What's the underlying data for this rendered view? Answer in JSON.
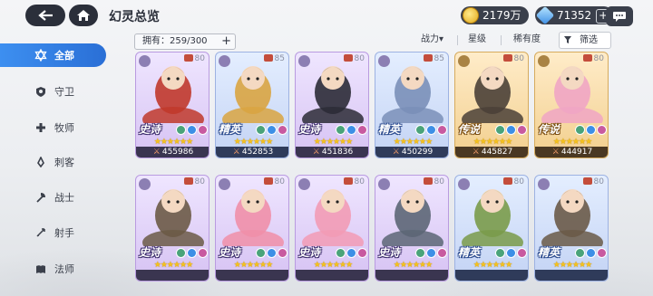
{
  "header": {
    "title": "幻灵总览",
    "gold": "2179万",
    "gems": "71352",
    "gem_plus": "+"
  },
  "sidebar": {
    "items": [
      {
        "label": "全部",
        "icon": "star-of-david-icon",
        "active": true
      },
      {
        "label": "守卫",
        "icon": "shield-icon"
      },
      {
        "label": "牧师",
        "icon": "cross-icon"
      },
      {
        "label": "刺客",
        "icon": "dagger-icon"
      },
      {
        "label": "战士",
        "icon": "axe-icon"
      },
      {
        "label": "射手",
        "icon": "bow-icon"
      },
      {
        "label": "法师",
        "icon": "spellbook-icon"
      }
    ]
  },
  "filter": {
    "owned_label": "拥有：259/300",
    "sort_power": "战力▾",
    "sort_star": "星级",
    "sort_rarity": "稀有度",
    "screen_button": "筛选"
  },
  "cards": [
    {
      "rarity": "史诗",
      "rarity_type": "epic",
      "level": "80",
      "power": "455986",
      "art": "red-bearded-dwarf-warrior",
      "skin": "#c9b6e9",
      "accent": "#c0392b"
    },
    {
      "rarity": "精英",
      "rarity_type": "elite",
      "level": "85",
      "power": "452853",
      "art": "pharaoh-mummy",
      "skin": "#c7d6f1",
      "accent": "#d9a441"
    },
    {
      "rarity": "史诗",
      "rarity_type": "epic",
      "level": "80",
      "power": "451836",
      "art": "dark-ninja-girl",
      "skin": "#cdbaea",
      "accent": "#2b2b36"
    },
    {
      "rarity": "精英",
      "rarity_type": "elite",
      "level": "85",
      "power": "450299",
      "art": "white-beard-monk",
      "skin": "#c6d4f1",
      "accent": "#7a8fb8"
    },
    {
      "rarity": "传说",
      "rarity_type": "legend",
      "level": "80",
      "power": "445827",
      "art": "horned-stone-golem",
      "skin": "#efd3a0",
      "accent": "#4a4037"
    },
    {
      "rarity": "传说",
      "rarity_type": "legend",
      "level": "80",
      "power": "444917",
      "art": "pink-hair-witch",
      "skin": "#f2d6a6",
      "accent": "#f0a5c4"
    },
    {
      "rarity": "史诗",
      "rarity_type": "epic",
      "level": "80",
      "power": "",
      "art": "horned-viking-warrior",
      "skin": "#cdb9ea",
      "accent": "#6b5a46"
    },
    {
      "rarity": "史诗",
      "rarity_type": "epic",
      "level": "80",
      "power": "",
      "art": "flower-fairy-girl",
      "skin": "#d2bdea",
      "accent": "#f08fa8"
    },
    {
      "rarity": "史诗",
      "rarity_type": "epic",
      "level": "80",
      "power": "",
      "art": "pink-mermaid",
      "skin": "#d1bfea",
      "accent": "#f29bb5"
    },
    {
      "rarity": "史诗",
      "rarity_type": "epic",
      "level": "80",
      "power": "",
      "art": "grey-werewolf",
      "skin": "#c9b8e6",
      "accent": "#5c6675"
    },
    {
      "rarity": "精英",
      "rarity_type": "elite",
      "level": "80",
      "power": "",
      "art": "goblin-hammer",
      "skin": "#c6d5f1",
      "accent": "#7a9b4a"
    },
    {
      "rarity": "精英",
      "rarity_type": "elite",
      "level": "80",
      "power": "",
      "art": "armored-horned-dwarf",
      "skin": "#c6d4f0",
      "accent": "#6a5a48"
    }
  ]
}
